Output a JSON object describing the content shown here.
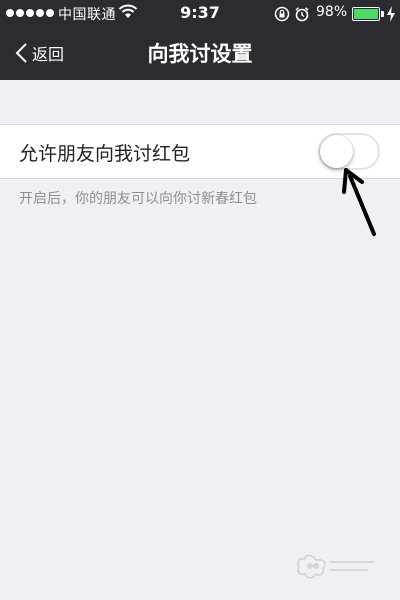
{
  "status_bar": {
    "carrier": "中国联通",
    "time": "9:37",
    "battery_percent": "98%",
    "battery_level": 0.98
  },
  "nav": {
    "back_label": "返回",
    "title": "向我讨设置"
  },
  "setting": {
    "label": "允许朋友向我讨红包",
    "enabled": false,
    "hint": "开启后，你的朋友可以向你讨新春红包"
  },
  "icons": {
    "back": "chevron-left-icon",
    "wifi": "wifi-icon",
    "lock": "rotation-lock-icon",
    "alarm": "alarm-icon",
    "battery": "battery-icon",
    "charging": "bolt-icon",
    "annotation": "arrow-icon"
  },
  "colors": {
    "nav_background": "#2b2b31",
    "page_background": "#efeff4",
    "battery_fill": "#4cd964",
    "hint_text": "#8e8e93"
  }
}
